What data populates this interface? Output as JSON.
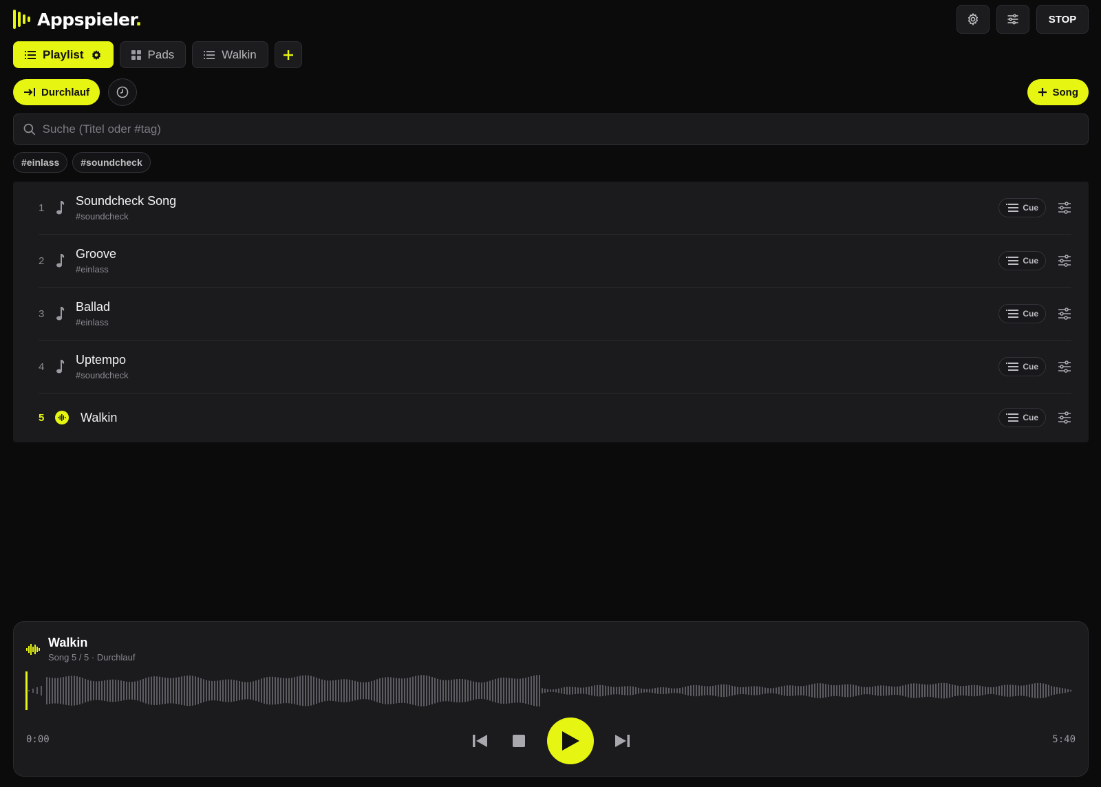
{
  "app": {
    "name": "Appspieler"
  },
  "header": {
    "stop_label": "STOP"
  },
  "tabs": [
    {
      "label": "Playlist"
    },
    {
      "label": "Pads"
    },
    {
      "label": "Walkin"
    }
  ],
  "mode": {
    "durchlauf_label": "Durchlauf",
    "song_label": "Song"
  },
  "search": {
    "placeholder": "Suche (Titel oder #tag)"
  },
  "tags": [
    "#einlass",
    "#soundcheck"
  ],
  "songs": [
    {
      "num": "1",
      "title": "Soundcheck Song",
      "tag": "#soundcheck",
      "cue": "Cue"
    },
    {
      "num": "2",
      "title": "Groove",
      "tag": "#einlass",
      "cue": "Cue"
    },
    {
      "num": "3",
      "title": "Ballad",
      "tag": "#einlass",
      "cue": "Cue"
    },
    {
      "num": "4",
      "title": "Uptempo",
      "tag": "#soundcheck",
      "cue": "Cue"
    },
    {
      "num": "5",
      "title": "Walkin",
      "tag": "",
      "cue": "Cue",
      "playing": true
    }
  ],
  "player": {
    "title": "Walkin",
    "subtitle": "Song 5 / 5 · Durchlauf",
    "time_current": "0:00",
    "time_total": "5:40",
    "progress": 0
  },
  "colors": {
    "accent": "#e6f511",
    "background": "#0b0b0c",
    "surface": "#1b1b1e"
  }
}
